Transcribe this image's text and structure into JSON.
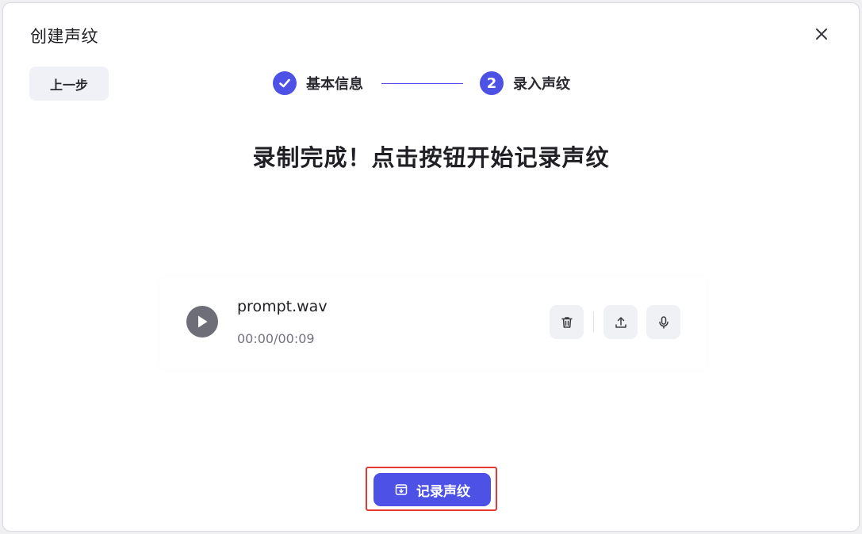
{
  "dialog": {
    "title": "创建声纹",
    "close_icon": "close-icon"
  },
  "back_button": {
    "label": "上一步"
  },
  "stepper": {
    "steps": [
      {
        "label": "基本信息",
        "status": "completed",
        "icon": "check-icon"
      },
      {
        "number": "2",
        "label": "录入声纹",
        "status": "active"
      }
    ],
    "accent_color": "#4d51e6"
  },
  "headline": "录制完成！点击按钮开始记录声纹",
  "audio": {
    "file_name": "prompt.wav",
    "time": "00:00/00:09",
    "actions": [
      {
        "name": "delete",
        "icon": "trash-icon"
      },
      {
        "name": "upload",
        "icon": "upload-icon"
      },
      {
        "name": "record",
        "icon": "microphone-icon"
      }
    ]
  },
  "record_button": {
    "label": "记录声纹",
    "icon": "save-record-icon",
    "color": "#4d51e6",
    "highlight_color": "#e53935"
  }
}
